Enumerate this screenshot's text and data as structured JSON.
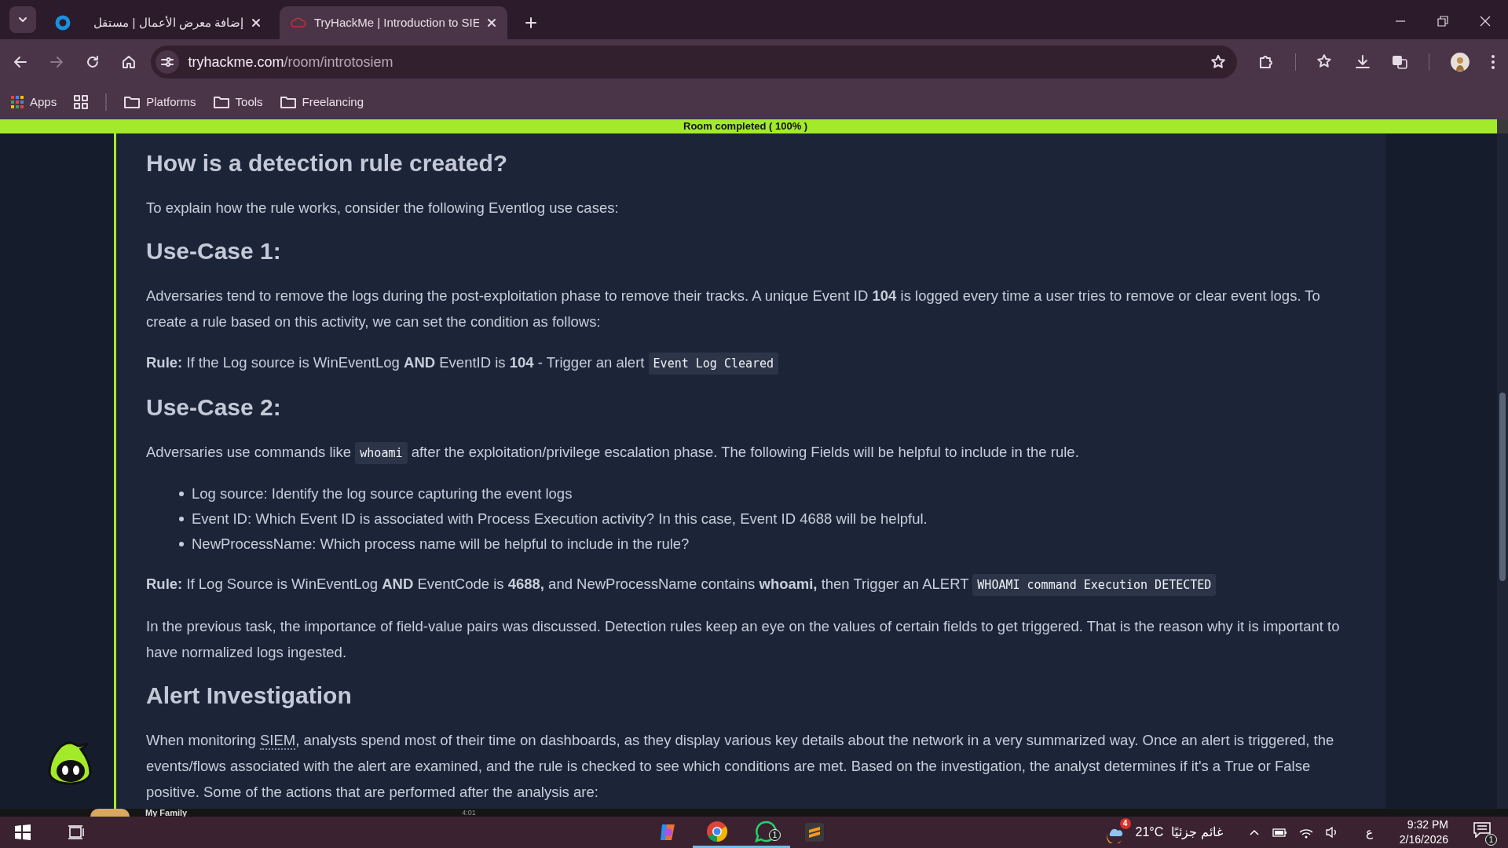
{
  "browser": {
    "tabs": [
      {
        "title": "إضافة معرض الأعمال | مستقل",
        "selected": false
      },
      {
        "title": "TryHackMe | Introduction to SIE",
        "selected": true
      }
    ],
    "address": {
      "host": "tryhackme.com",
      "path": "/room/introtosiem"
    },
    "bookmarks": [
      {
        "kind": "apps",
        "label": "Apps"
      },
      {
        "kind": "grid"
      },
      {
        "kind": "folder",
        "label": "Platforms"
      },
      {
        "kind": "folder",
        "label": "Tools"
      },
      {
        "kind": "folder",
        "label": "Freelancing"
      }
    ]
  },
  "progress_banner": {
    "text": "Room completed ( 100% )",
    "level": 1
  },
  "article": [
    {
      "kind": "h",
      "text": "How is a detection rule created?"
    },
    {
      "kind": "p",
      "parts": [
        {
          "kind": "text",
          "text": "To explain how the rule works, consider the following Eventlog use cases:"
        }
      ]
    },
    {
      "kind": "h",
      "text": "Use-Case 1:"
    },
    {
      "kind": "p",
      "parts": [
        {
          "kind": "text",
          "text": "Adversaries tend to remove the logs during the post-exploitation phase to remove their tracks. A unique Event ID **104** is logged every time a user tries to remove or clear event logs. To create a rule based on this activity, we can set the condition as follows:"
        }
      ]
    },
    {
      "kind": "p",
      "parts": [
        {
          "kind": "text",
          "text": "**Rule:** If the Log source is WinEventLog **AND** EventID is **104** - Trigger an alert"
        },
        {
          "kind": "code",
          "text": "Event Log Cleared"
        }
      ]
    },
    {
      "kind": "h",
      "text": "Use-Case 2:"
    },
    {
      "kind": "p",
      "parts": [
        {
          "kind": "text",
          "text": "Adversaries use commands like"
        },
        {
          "kind": "code",
          "text": "whoami"
        },
        {
          "kind": "text",
          "text": "after the exploitation/privilege escalation phase. The following Fields will be helpful to include in the rule."
        }
      ]
    },
    {
      "kind": "ul",
      "items": [
        "Log source: Identify the log source capturing the event logs",
        "Event ID: Which Event ID is associated with Process Execution activity? In this case, Event ID 4688 will be helpful.",
        "NewProcessName: Which process name will be helpful to include in the rule?"
      ]
    },
    {
      "kind": "p",
      "parts": [
        {
          "kind": "text",
          "text": "**Rule:** If Log Source is WinEventLog **AND** EventCode is **4688,** and NewProcessName contains **whoami,** then Trigger an ALERT"
        },
        {
          "kind": "code",
          "text": "WHOAMI command Execution DETECTED"
        }
      ]
    },
    {
      "kind": "p",
      "parts": [
        {
          "kind": "text",
          "text": "In the previous task, the importance of field-value pairs was discussed. Detection rules keep an eye on the values of certain fields to get triggered. That is the reason why it is important to have normalized logs ingested."
        }
      ]
    },
    {
      "kind": "h",
      "text": "Alert Investigation"
    },
    {
      "kind": "p",
      "parts": [
        {
          "kind": "text",
          "text": "When monitoring"
        },
        {
          "kind": "abbr",
          "text": "SIEM"
        },
        {
          "kind": "text",
          "text": ", analysts spend most of their time on dashboards, as they display various key details about the network in a very summarized way. Once an alert is triggered, the events/flows associated with the alert are examined, and the rule is checked to see which conditions are met. Based on the investigation, the analyst determines if it's a True or False positive. Some of the actions that are performed after the analysis are:"
        }
      ]
    }
  ],
  "peek": {
    "title": "My Family",
    "time": "4:01"
  },
  "taskbar": {
    "apps": [
      {
        "kind": "copilot",
        "active": false
      },
      {
        "kind": "chrome",
        "active": true
      },
      {
        "kind": "whatsapp",
        "active": true,
        "badge": "1"
      },
      {
        "kind": "sublime",
        "active": false
      }
    ],
    "weather": {
      "badge": "4",
      "temp": "21°C",
      "text": "غائم جزئيًا"
    },
    "lang": "ع",
    "time": "9:32 PM",
    "date": "2/16/2026",
    "notifications": "1"
  }
}
